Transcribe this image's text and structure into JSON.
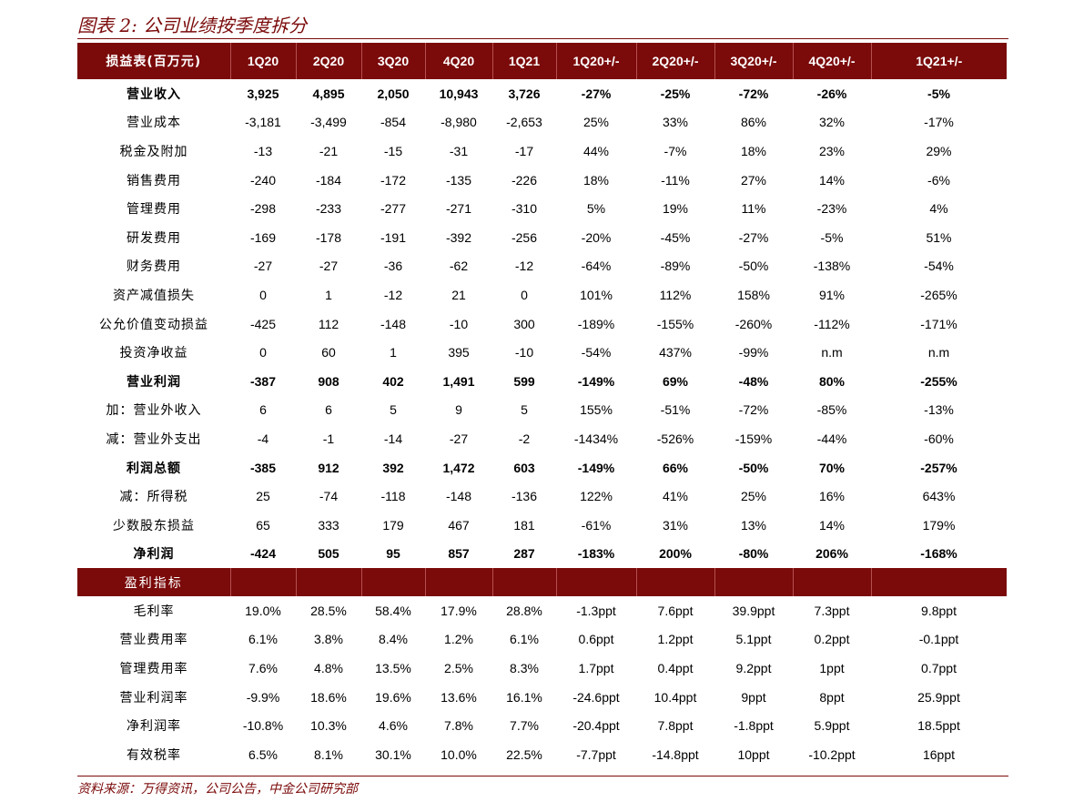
{
  "title": "图表 2: 公司业绩按季度拆分",
  "source": "资料来源：万得资讯，公司公告，中金公司研究部",
  "colors": {
    "accent": "#7b0a0a",
    "header_text": "#ffffff"
  },
  "header": [
    "损益表(百万元)",
    "1Q20",
    "2Q20",
    "3Q20",
    "4Q20",
    "1Q21",
    "1Q20+/-",
    "2Q20+/-",
    "3Q20+/-",
    "4Q20+/-",
    "1Q21+/-"
  ],
  "income_rows": [
    {
      "cells": [
        "营业收入",
        "3,925",
        "4,895",
        "2,050",
        "10,943",
        "3,726",
        "-27%",
        "-25%",
        "-72%",
        "-26%",
        "-5%"
      ],
      "bold": true
    },
    {
      "cells": [
        "营业成本",
        "-3,181",
        "-3,499",
        "-854",
        "-8,980",
        "-2,653",
        "25%",
        "33%",
        "86%",
        "32%",
        "-17%"
      ],
      "bold": false
    },
    {
      "cells": [
        "税金及附加",
        "-13",
        "-21",
        "-15",
        "-31",
        "-17",
        "44%",
        "-7%",
        "18%",
        "23%",
        "29%"
      ],
      "bold": false
    },
    {
      "cells": [
        "销售费用",
        "-240",
        "-184",
        "-172",
        "-135",
        "-226",
        "18%",
        "-11%",
        "27%",
        "14%",
        "-6%"
      ],
      "bold": false
    },
    {
      "cells": [
        "管理费用",
        "-298",
        "-233",
        "-277",
        "-271",
        "-310",
        "5%",
        "19%",
        "11%",
        "-23%",
        "4%"
      ],
      "bold": false
    },
    {
      "cells": [
        "研发费用",
        "-169",
        "-178",
        "-191",
        "-392",
        "-256",
        "-20%",
        "-45%",
        "-27%",
        "-5%",
        "51%"
      ],
      "bold": false
    },
    {
      "cells": [
        "财务费用",
        "-27",
        "-27",
        "-36",
        "-62",
        "-12",
        "-64%",
        "-89%",
        "-50%",
        "-138%",
        "-54%"
      ],
      "bold": false
    },
    {
      "cells": [
        "资产减值损失",
        "0",
        "1",
        "-12",
        "21",
        "0",
        "101%",
        "112%",
        "158%",
        "91%",
        "-265%"
      ],
      "bold": false
    },
    {
      "cells": [
        "公允价值变动损益",
        "-425",
        "112",
        "-148",
        "-10",
        "300",
        "-189%",
        "-155%",
        "-260%",
        "-112%",
        "-171%"
      ],
      "bold": false
    },
    {
      "cells": [
        "投资净收益",
        "0",
        "60",
        "1",
        "395",
        "-10",
        "-54%",
        "437%",
        "-99%",
        "n.m",
        "n.m"
      ],
      "bold": false
    },
    {
      "cells": [
        "营业利润",
        "-387",
        "908",
        "402",
        "1,491",
        "599",
        "-149%",
        "69%",
        "-48%",
        "80%",
        "-255%"
      ],
      "bold": true
    },
    {
      "cells": [
        "加：营业外收入",
        "6",
        "6",
        "5",
        "9",
        "5",
        "155%",
        "-51%",
        "-72%",
        "-85%",
        "-13%"
      ],
      "bold": false
    },
    {
      "cells": [
        "减：营业外支出",
        "-4",
        "-1",
        "-14",
        "-27",
        "-2",
        "-1434%",
        "-526%",
        "-159%",
        "-44%",
        "-60%"
      ],
      "bold": false
    },
    {
      "cells": [
        "利润总额",
        "-385",
        "912",
        "392",
        "1,472",
        "603",
        "-149%",
        "66%",
        "-50%",
        "70%",
        "-257%"
      ],
      "bold": true
    },
    {
      "cells": [
        "减：所得税",
        "25",
        "-74",
        "-118",
        "-148",
        "-136",
        "122%",
        "41%",
        "25%",
        "16%",
        "643%"
      ],
      "bold": false
    },
    {
      "cells": [
        "少数股东损益",
        "65",
        "333",
        "179",
        "467",
        "181",
        "-61%",
        "31%",
        "13%",
        "14%",
        "179%"
      ],
      "bold": false
    },
    {
      "cells": [
        "净利润",
        "-424",
        "505",
        "95",
        "857",
        "287",
        "-183%",
        "200%",
        "-80%",
        "206%",
        "-168%"
      ],
      "bold": true
    }
  ],
  "profit_section_label": "盈利指标",
  "profit_rows": [
    {
      "cells": [
        "毛利率",
        "19.0%",
        "28.5%",
        "58.4%",
        "17.9%",
        "28.8%",
        "-1.3ppt",
        "7.6ppt",
        "39.9ppt",
        "7.3ppt",
        "9.8ppt"
      ]
    },
    {
      "cells": [
        "营业费用率",
        "6.1%",
        "3.8%",
        "8.4%",
        "1.2%",
        "6.1%",
        "0.6ppt",
        "1.2ppt",
        "5.1ppt",
        "0.2ppt",
        "-0.1ppt"
      ]
    },
    {
      "cells": [
        "管理费用率",
        "7.6%",
        "4.8%",
        "13.5%",
        "2.5%",
        "8.3%",
        "1.7ppt",
        "0.4ppt",
        "9.2ppt",
        "1ppt",
        "0.7ppt"
      ]
    },
    {
      "cells": [
        "营业利润率",
        "-9.9%",
        "18.6%",
        "19.6%",
        "13.6%",
        "16.1%",
        "-24.6ppt",
        "10.4ppt",
        "9ppt",
        "8ppt",
        "25.9ppt"
      ]
    },
    {
      "cells": [
        "净利润率",
        "-10.8%",
        "10.3%",
        "4.6%",
        "7.8%",
        "7.7%",
        "-20.4ppt",
        "7.8ppt",
        "-1.8ppt",
        "5.9ppt",
        "18.5ppt"
      ]
    },
    {
      "cells": [
        "有效税率",
        "6.5%",
        "8.1%",
        "30.1%",
        "10.0%",
        "22.5%",
        "-7.7ppt",
        "-14.8ppt",
        "10ppt",
        "-10.2ppt",
        "16ppt"
      ]
    }
  ]
}
